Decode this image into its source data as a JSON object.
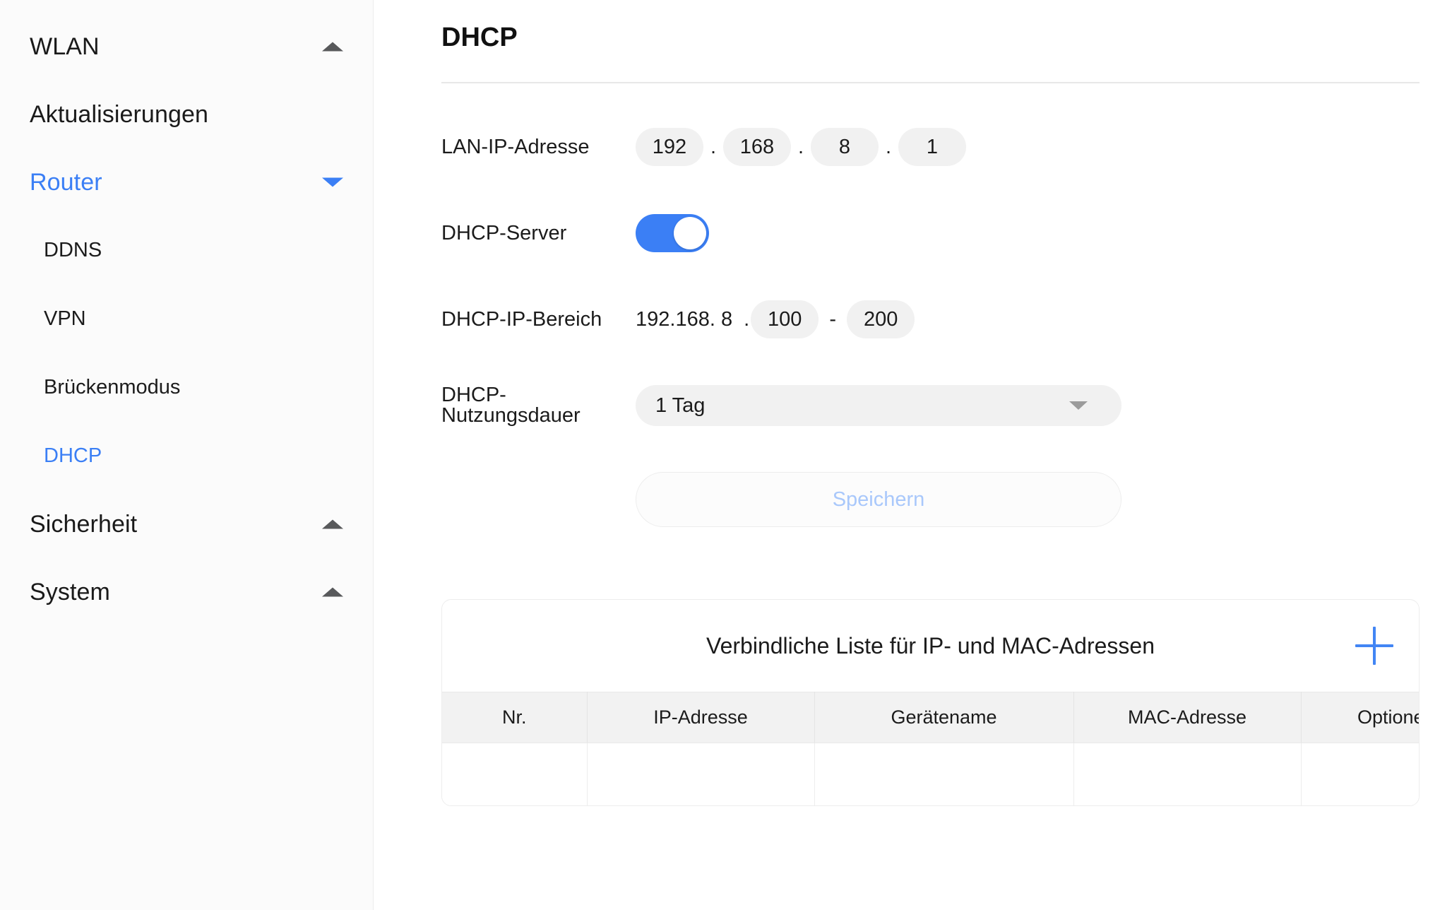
{
  "sidebar": {
    "groups": [
      {
        "label": "WLAN",
        "caret": "caret-up-icon",
        "active": false,
        "children": []
      },
      {
        "label": "Aktualisierungen",
        "caret": null,
        "active": false,
        "children": []
      },
      {
        "label": "Router",
        "caret": "caret-down-icon",
        "active": true,
        "children": [
          {
            "label": "DDNS",
            "active": false
          },
          {
            "label": "VPN",
            "active": false
          },
          {
            "label": "Brückenmodus",
            "active": false
          },
          {
            "label": "DHCP",
            "active": true
          }
        ]
      },
      {
        "label": "Sicherheit",
        "caret": "caret-up-icon",
        "active": false,
        "children": []
      },
      {
        "label": "System",
        "caret": "caret-up-icon",
        "active": false,
        "children": []
      }
    ]
  },
  "main": {
    "page_title": "DHCP",
    "lan_ip": {
      "label": "LAN-IP-Adresse",
      "octets": [
        "192",
        "168",
        "8",
        "1"
      ],
      "separator": "."
    },
    "dhcp_server": {
      "label": "DHCP-Server",
      "enabled": true
    },
    "dhcp_range": {
      "label": "DHCP-IP-Bereich",
      "prefix": "192.168. 8  .",
      "start": "100",
      "separator": "-",
      "end": "200"
    },
    "lease_time": {
      "label": "DHCP-Nutzungsdauer",
      "value": "1 Tag"
    },
    "save_button": {
      "label": "Speichern",
      "disabled": true
    },
    "binding_card": {
      "title": "Verbindliche Liste für IP- und MAC-Adressen",
      "add_icon": "plus-icon",
      "columns": [
        "Nr.",
        "IP-Adresse",
        "Gerätename",
        "MAC-Adresse",
        "Optionen"
      ],
      "rows": [
        [
          "",
          "",
          "",
          "",
          ""
        ]
      ]
    }
  },
  "colors": {
    "accent": "#3b7ff5",
    "accent_plus": "#4285f4",
    "disabled_text": "#a9c8fb",
    "field_bg": "#f1f1f1",
    "sidebar_bg": "#fbfbfb"
  }
}
